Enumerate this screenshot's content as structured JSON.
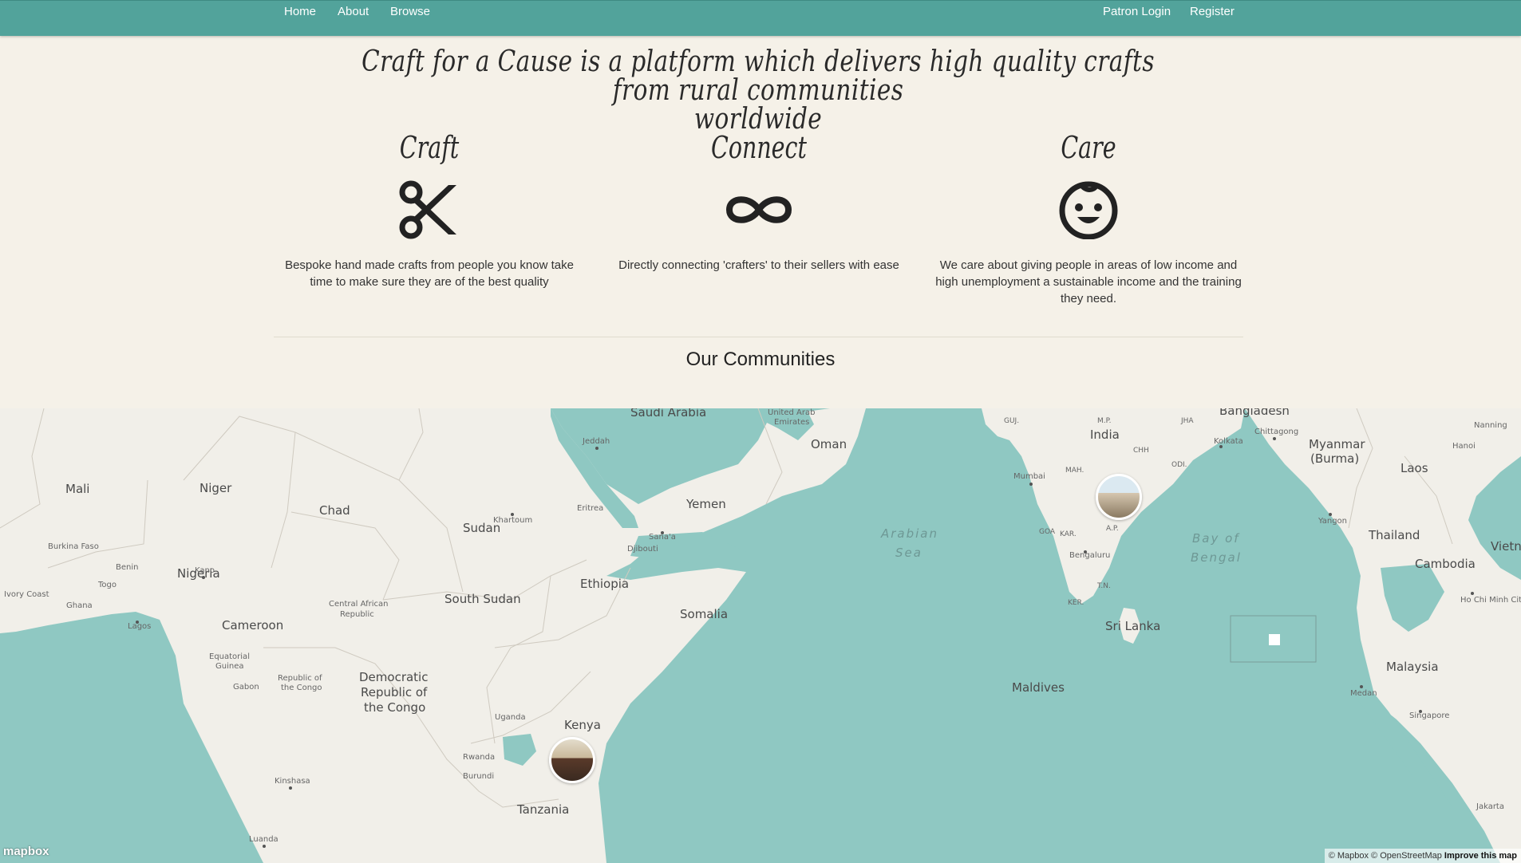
{
  "nav": {
    "left": [
      "Home",
      "About",
      "Browse"
    ],
    "right": [
      "Patron Login",
      "Register"
    ]
  },
  "tagline_line1": "Craft for a Cause is a platform which delivers high quality crafts from rural communities",
  "tagline_line2": "worldwide",
  "features": [
    {
      "title": "Craft",
      "icon": "scissors-icon",
      "text": "Bespoke hand made crafts from people you know take time to make sure they are of the best quality"
    },
    {
      "title": "Connect",
      "icon": "infinity-icon",
      "text": "Directly connecting 'crafters' to their sellers with ease"
    },
    {
      "title": "Care",
      "icon": "baby-face-icon",
      "text": "We care about giving people in areas of low income and high unemployment a sustainable income and the training they need."
    }
  ],
  "communities_title": "Our Communities",
  "map": {
    "countries": [
      "Saudi Arabia",
      "United Arab Emirates",
      "Oman",
      "Yemen",
      "Mali",
      "Niger",
      "Chad",
      "Sudan",
      "Eritrea",
      "Djibouti",
      "Ethiopia",
      "Somalia",
      "South Sudan",
      "Nigeria",
      "Cameroon",
      "Central African Republic",
      "Burkina Faso",
      "Benin",
      "Togo",
      "Ghana",
      "Ivory Coast",
      "Equatorial Guinea",
      "Gabon",
      "Republic of the Congo",
      "Democratic Republic of the Congo",
      "Uganda",
      "Kenya",
      "Rwanda",
      "Burundi",
      "Tanzania",
      "India",
      "Bangladesh",
      "Myanmar (Burma)",
      "Laos",
      "Thailand",
      "Vietnam",
      "Cambodia",
      "Sri Lanka",
      "Maldives",
      "Malaysia"
    ],
    "cities": [
      "Jeddah",
      "Sana'a",
      "Khartoum",
      "Kano",
      "Lagos",
      "Kinshasa",
      "Luanda",
      "Mumbai",
      "Bengaluru",
      "Kolkata",
      "Chittagong",
      "Yangon",
      "Hanoi",
      "Nanning",
      "Ho Chi Minh City",
      "Medan",
      "Singapore",
      "Jakarta"
    ],
    "seas": [
      "Arabian Sea",
      "Bay of Bengal"
    ],
    "regions": [
      "M.P.",
      "JHA",
      "CHH",
      "MAH.",
      "ODI.",
      "A.P.",
      "KAR.",
      "T.N.",
      "KER.",
      "GOA",
      "GUJ."
    ],
    "logo": "mapbox",
    "attribution": "© Mapbox © OpenStreetMap",
    "improve_link": "Improve this map"
  },
  "colors": {
    "nav": "#52a39b",
    "background": "#f5f1e8",
    "water": "#8fc8c2",
    "land": "#f1efe9"
  }
}
